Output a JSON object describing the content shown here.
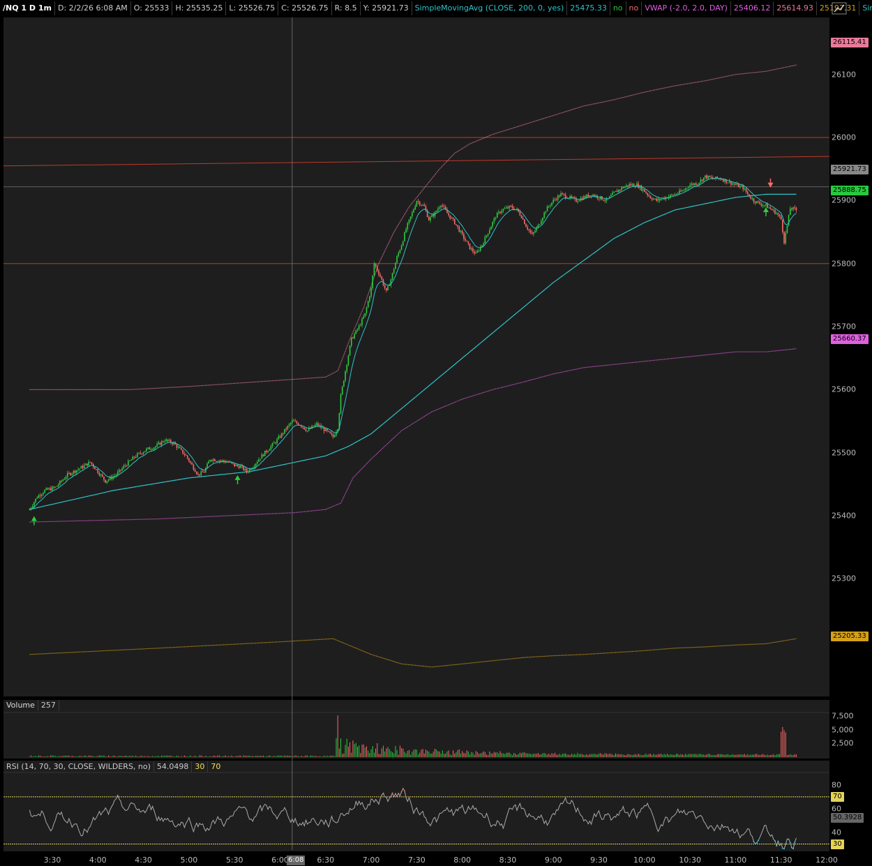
{
  "header": {
    "symbol": "/NQ 1 D 1m",
    "date": "D: 2/2/26 6:08 AM",
    "open": "O: 25533",
    "high": "H: 25535.25",
    "low": "L: 25526.75",
    "close": "C: 25526.75",
    "range": "R: 8.5",
    "y": "Y: 25921.73",
    "sma_label": "SimpleMovingAvg (CLOSE, 200, 0, yes)",
    "sma_value": "25475.33",
    "sma_flag1": "no",
    "sma_flag2": "no",
    "vwap_label": "VWAP (-2.0, 2.0, DAY)",
    "vwap_value": "25406.12",
    "vwap_upper": "25614.93",
    "vwap_lower": "25197.31",
    "simple_more": "Simple..."
  },
  "price_badges": {
    "upper_band": "26115.41",
    "crosshair": "25921.73",
    "last": "25888.75",
    "vwap": "25660.37",
    "lower_band": "25205.33"
  },
  "volume_panel": {
    "label": "Volume",
    "value": "257"
  },
  "rsi_panel": {
    "label": "RSI (14, 70, 30, CLOSE, WILDERS, no)",
    "value": "54.0498",
    "oversold": "30",
    "overbought": "70",
    "badge_value": "50.3928"
  },
  "cursor_time": "6:08",
  "colors": {
    "background": "#1e1e1e",
    "up": "#2ecc40",
    "down": "#ff6b6b",
    "sma200": "#2ec4c9",
    "ema_fast": "#2ec4c9",
    "vwap": "#e060e0",
    "upper_band": "#e87b9a",
    "lower_band": "#d4a017",
    "level_line": "#c0392b",
    "rsi_line": "#aaaaaa",
    "rsi_ob": "#ff6b6b",
    "rsi_os": "#3bd1e8"
  },
  "chart_data": [
    {
      "type": "candlestick",
      "title": "/NQ 1 D 1m",
      "y_ticks": [
        25300,
        25400,
        25500,
        25600,
        25700,
        25800,
        25900,
        26000,
        26100
      ],
      "ylim": [
        25130,
        26165
      ],
      "x_ticks": [
        "3:30",
        "4:00",
        "4:30",
        "5:00",
        "5:30",
        "6:00",
        "6:30",
        "7:00",
        "7:30",
        "8:00",
        "8:30",
        "9:00",
        "9:30",
        "10:00",
        "10:30",
        "11:00",
        "11:30",
        "12:00"
      ],
      "xlim_minutes": [
        195,
        725
      ],
      "close_path": [
        [
          195,
          25410
        ],
        [
          200,
          25430
        ],
        [
          205,
          25440
        ],
        [
          212,
          25445
        ],
        [
          220,
          25465
        ],
        [
          228,
          25475
        ],
        [
          235,
          25485
        ],
        [
          240,
          25470
        ],
        [
          245,
          25455
        ],
        [
          252,
          25465
        ],
        [
          258,
          25480
        ],
        [
          265,
          25495
        ],
        [
          272,
          25505
        ],
        [
          278,
          25510
        ],
        [
          284,
          25520
        ],
        [
          290,
          25515
        ],
        [
          294,
          25505
        ],
        [
          298,
          25495
        ],
        [
          302,
          25480
        ],
        [
          306,
          25465
        ],
        [
          310,
          25470
        ],
        [
          314,
          25490
        ],
        [
          320,
          25488
        ],
        [
          326,
          25485
        ],
        [
          330,
          25480
        ],
        [
          334,
          25478
        ],
        [
          338,
          25470
        ],
        [
          342,
          25478
        ],
        [
          346,
          25490
        ],
        [
          352,
          25505
        ],
        [
          358,
          25520
        ],
        [
          363,
          25535
        ],
        [
          368,
          25550
        ],
        [
          373,
          25545
        ],
        [
          378,
          25535
        ],
        [
          384,
          25545
        ],
        [
          390,
          25535
        ],
        [
          395,
          25525
        ],
        [
          398,
          25540
        ],
        [
          400,
          25590
        ],
        [
          403,
          25630
        ],
        [
          407,
          25680
        ],
        [
          412,
          25700
        ],
        [
          416,
          25720
        ],
        [
          420,
          25760
        ],
        [
          422,
          25800
        ],
        [
          426,
          25780
        ],
        [
          430,
          25755
        ],
        [
          433,
          25775
        ],
        [
          437,
          25810
        ],
        [
          440,
          25830
        ],
        [
          443,
          25855
        ],
        [
          447,
          25880
        ],
        [
          450,
          25900
        ],
        [
          455,
          25890
        ],
        [
          458,
          25870
        ],
        [
          462,
          25880
        ],
        [
          466,
          25895
        ],
        [
          470,
          25880
        ],
        [
          475,
          25865
        ],
        [
          480,
          25845
        ],
        [
          485,
          25825
        ],
        [
          489,
          25815
        ],
        [
          493,
          25830
        ],
        [
          497,
          25850
        ],
        [
          502,
          25875
        ],
        [
          506,
          25885
        ],
        [
          512,
          25890
        ],
        [
          516,
          25885
        ],
        [
          519,
          25875
        ],
        [
          522,
          25860
        ],
        [
          526,
          25845
        ],
        [
          530,
          25860
        ],
        [
          535,
          25885
        ],
        [
          540,
          25900
        ],
        [
          545,
          25910
        ],
        [
          550,
          25905
        ],
        [
          555,
          25900
        ],
        [
          560,
          25905
        ],
        [
          565,
          25910
        ],
        [
          570,
          25905
        ],
        [
          575,
          25900
        ],
        [
          580,
          25912
        ],
        [
          585,
          25920
        ],
        [
          590,
          25925
        ],
        [
          595,
          25925
        ],
        [
          600,
          25915
        ],
        [
          604,
          25905
        ],
        [
          608,
          25900
        ],
        [
          614,
          25905
        ],
        [
          620,
          25910
        ],
        [
          625,
          25915
        ],
        [
          630,
          25925
        ],
        [
          635,
          25928
        ],
        [
          640,
          25938
        ],
        [
          645,
          25935
        ],
        [
          650,
          25935
        ],
        [
          655,
          25930
        ],
        [
          660,
          25925
        ],
        [
          665,
          25920
        ],
        [
          668,
          25910
        ],
        [
          672,
          25900
        ],
        [
          676,
          25895
        ],
        [
          680,
          25892
        ],
        [
          684,
          25885
        ],
        [
          687,
          25880
        ],
        [
          690,
          25870
        ],
        [
          692,
          25835
        ],
        [
          694,
          25860
        ],
        [
          696,
          25888
        ],
        [
          700,
          25885
        ]
      ],
      "series": [
        {
          "name": "SimpleMovingAvg (CLOSE, 200, 0, yes)",
          "values_path": [
            [
              195,
              25410
            ],
            [
              250,
              25440
            ],
            [
              300,
              25460
            ],
            [
              340,
              25470
            ],
            [
              370,
              25485
            ],
            [
              390,
              25495
            ],
            [
              405,
              25510
            ],
            [
              420,
              25530
            ],
            [
              440,
              25570
            ],
            [
              460,
              25610
            ],
            [
              480,
              25650
            ],
            [
              500,
              25690
            ],
            [
              520,
              25730
            ],
            [
              540,
              25770
            ],
            [
              560,
              25805
            ],
            [
              580,
              25840
            ],
            [
              600,
              25865
            ],
            [
              620,
              25885
            ],
            [
              640,
              25895
            ],
            [
              660,
              25905
            ],
            [
              680,
              25910
            ],
            [
              700,
              25910
            ]
          ]
        },
        {
          "name": "VWAP",
          "values_path": [
            [
              195,
              25390
            ],
            [
              280,
              25395
            ],
            [
              370,
              25405
            ],
            [
              390,
              25410
            ],
            [
              400,
              25420
            ],
            [
              408,
              25460
            ],
            [
              420,
              25490
            ],
            [
              440,
              25535
            ],
            [
              460,
              25565
            ],
            [
              480,
              25585
            ],
            [
              500,
              25600
            ],
            [
              520,
              25612
            ],
            [
              540,
              25625
            ],
            [
              560,
              25635
            ],
            [
              580,
              25640
            ],
            [
              600,
              25645
            ],
            [
              620,
              25650
            ],
            [
              640,
              25655
            ],
            [
              660,
              25660
            ],
            [
              680,
              25660
            ],
            [
              700,
              25665
            ]
          ]
        },
        {
          "name": "VWAP upper",
          "values_path": [
            [
              195,
              25600
            ],
            [
              260,
              25600
            ],
            [
              300,
              25605
            ],
            [
              360,
              25615
            ],
            [
              390,
              25620
            ],
            [
              398,
              25630
            ],
            [
              406,
              25680
            ],
            [
              415,
              25730
            ],
            [
              425,
              25800
            ],
            [
              435,
              25850
            ],
            [
              445,
              25890
            ],
            [
              455,
              25920
            ],
            [
              465,
              25950
            ],
            [
              475,
              25975
            ],
            [
              485,
              25990
            ],
            [
              500,
              26005
            ],
            [
              520,
              26020
            ],
            [
              540,
              26035
            ],
            [
              560,
              26050
            ],
            [
              580,
              26060
            ],
            [
              600,
              26072
            ],
            [
              620,
              26082
            ],
            [
              640,
              26090
            ],
            [
              660,
              26100
            ],
            [
              680,
              26105
            ],
            [
              700,
              26115
            ]
          ]
        },
        {
          "name": "VWAP lower",
          "values_path": [
            [
              195,
              25180
            ],
            [
              280,
              25190
            ],
            [
              360,
              25200
            ],
            [
              395,
              25205
            ],
            [
              405,
              25195
            ],
            [
              420,
              25180
            ],
            [
              440,
              25165
            ],
            [
              460,
              25160
            ],
            [
              480,
              25165
            ],
            [
              500,
              25170
            ],
            [
              520,
              25175
            ],
            [
              540,
              25178
            ],
            [
              560,
              25180
            ],
            [
              580,
              25183
            ],
            [
              600,
              25186
            ],
            [
              620,
              25190
            ],
            [
              640,
              25192
            ],
            [
              660,
              25195
            ],
            [
              680,
              25197
            ],
            [
              700,
              25205
            ]
          ]
        }
      ],
      "levels": [
        26000,
        25800
      ],
      "sloped_level": [
        [
          195,
          25955
        ],
        [
          700,
          25970
        ]
      ],
      "crosshair": {
        "minute": 368,
        "price": 25921.73
      }
    },
    {
      "type": "bar",
      "title": "Volume",
      "y_ticks": [
        2500,
        5000,
        7500
      ],
      "ylim": [
        0,
        8000
      ],
      "spike_minute": 398,
      "peak_value": 7600
    },
    {
      "type": "line",
      "title": "RSI (14, 70, 30, CLOSE, WILDERS, no)",
      "y_ticks": [
        30,
        40,
        60,
        70,
        80
      ],
      "ylim": [
        25,
        90
      ],
      "overbought": 70,
      "oversold": 30
    }
  ]
}
